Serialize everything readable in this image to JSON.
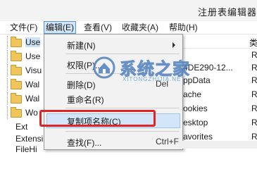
{
  "window": {
    "title": "注册表编辑器"
  },
  "menubar": [
    {
      "label": "文件(F)"
    },
    {
      "label": "编辑(E)"
    },
    {
      "label": "查看(V)"
    },
    {
      "label": "收藏夹(A)"
    },
    {
      "label": "帮助(H)"
    }
  ],
  "tree": {
    "items": [
      "Use",
      "Use",
      "Visu",
      "Wal",
      "Wal",
      "Wo",
      "Ext",
      "Extensi",
      "FileHi"
    ]
  },
  "list": {
    "column_header": "类",
    "rows": [
      {
        "name": "",
        "type": "R"
      },
      {
        "name": "4DE290-12...",
        "type": "R"
      },
      {
        "name": "ppData",
        "type": "R"
      },
      {
        "name": "ache",
        "type": "R"
      },
      {
        "name": "ookies",
        "type": "R"
      },
      {
        "name": "esktop",
        "type": "R"
      },
      {
        "name": "avorites",
        "type": "R"
      }
    ]
  },
  "context_menu": {
    "items": [
      {
        "label": "新建(N)",
        "shortcut": "",
        "submenu": true
      },
      {
        "label": "权限(P)...",
        "shortcut": ""
      },
      {
        "label": "删除(D)",
        "shortcut": "Del"
      },
      {
        "label": "重命名(R)",
        "shortcut": ""
      },
      {
        "label": "复制项名称(C)",
        "shortcut": ""
      },
      {
        "label": "查找(F)...",
        "shortcut": "Ctrl+F"
      }
    ]
  },
  "watermark": {
    "text": "系统之家",
    "sub": "XITONGZHIJIA.NET"
  },
  "colors": {
    "highlight_box": "#e02424",
    "menu_hover": "#d3e5f8",
    "accent": "#5c95d1"
  }
}
